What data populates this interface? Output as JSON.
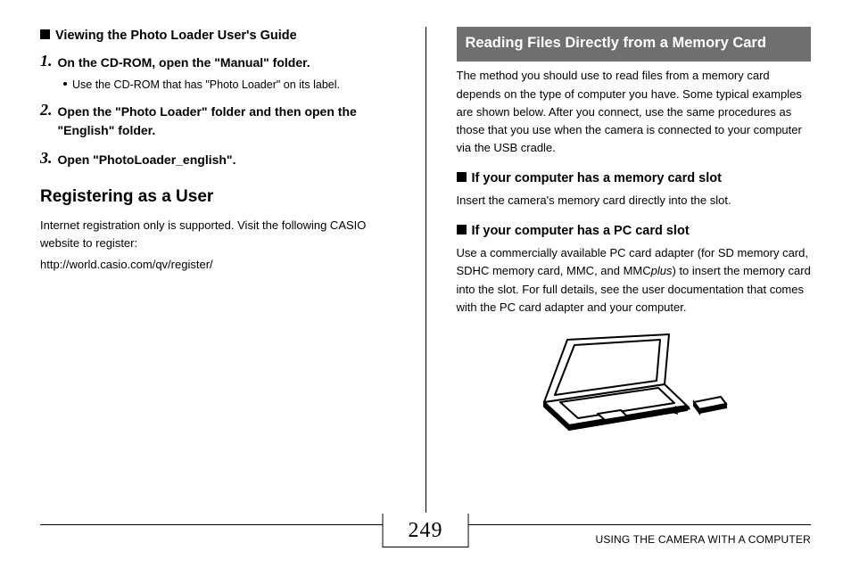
{
  "left": {
    "heading1": "Viewing the Photo Loader User's Guide",
    "step1_num": "1.",
    "step1_text": "On the CD-ROM, open the \"Manual\" folder.",
    "step1_sub": "Use the CD-ROM that has \"Photo Loader\" on its label.",
    "step2_num": "2.",
    "step2_text": "Open the \"Photo Loader\" folder and then open the \"English\" folder.",
    "step3_num": "3.",
    "step3_text": "Open \"PhotoLoader_english\".",
    "h2": "Registering as a User",
    "reg_p": "Internet registration only is supported. Visit the following CASIO website to register:",
    "reg_url": "http://world.casio.com/qv/register/"
  },
  "right": {
    "box_title": "Reading Files Directly from a Memory Card",
    "intro_p": "The method you should use to read files from a memory card depends on the type of computer you have. Some typical examples are shown below. After you connect, use the same procedures as those that you use when the camera is connected to your computer via the USB cradle.",
    "sub1_h": "If your computer has a memory card slot",
    "sub1_p": "Insert the camera's memory card directly into the slot.",
    "sub2_h": "If your computer has a PC card slot",
    "sub2_p_a": "Use a commercially available PC card adapter (for SD memory card, SDHC memory card, MMC, and MMC",
    "sub2_p_ital": "plus",
    "sub2_p_b": ") to insert the memory card into the slot. For full details, see the user documentation that comes with the PC card adapter and your computer."
  },
  "footer": {
    "page_number": "249",
    "section": "USING THE CAMERA WITH A COMPUTER"
  }
}
